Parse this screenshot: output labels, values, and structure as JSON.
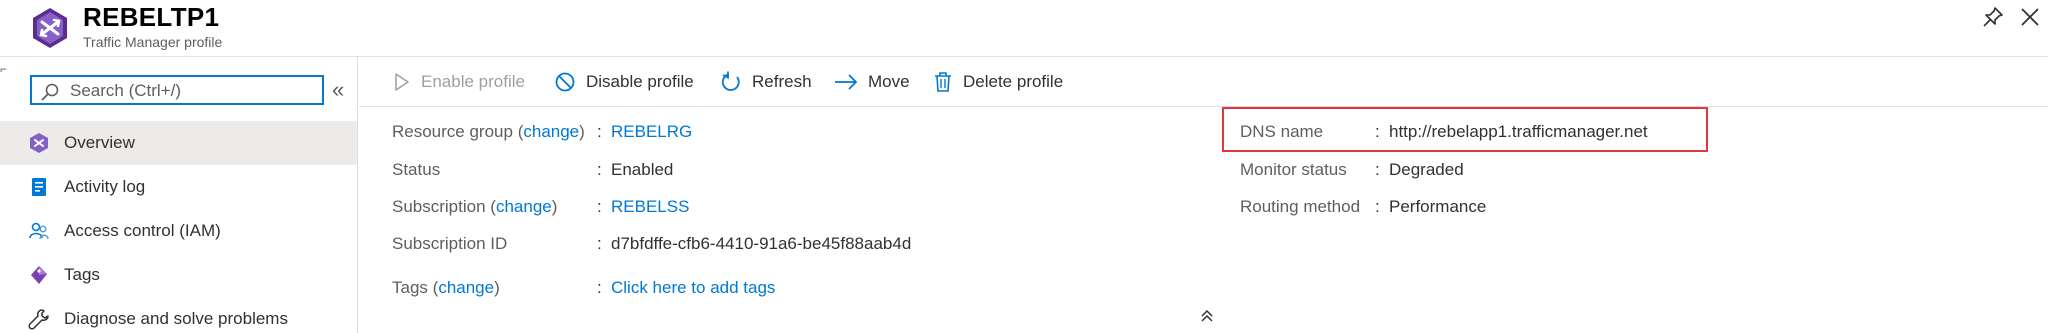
{
  "header": {
    "title": "REBELTP1",
    "subtitle": "Traffic Manager profile",
    "logo_icon": "traffic-manager-icon",
    "pin_icon": "pin-icon",
    "close_icon": "close-icon"
  },
  "search": {
    "placeholder": "Search (Ctrl+/)",
    "value": ""
  },
  "sidebar": {
    "collapse_glyph": "«",
    "items": [
      {
        "label": "Overview",
        "icon": "overview-icon",
        "active": true
      },
      {
        "label": "Activity log",
        "icon": "activity-log-icon",
        "active": false
      },
      {
        "label": "Access control (IAM)",
        "icon": "access-control-icon",
        "active": false
      },
      {
        "label": "Tags",
        "icon": "tag-icon",
        "active": false
      },
      {
        "label": "Diagnose and solve problems",
        "icon": "wrench-icon",
        "active": false
      }
    ]
  },
  "toolbar": {
    "enable_label": "Enable profile",
    "disable_label": "Disable profile",
    "refresh_label": "Refresh",
    "move_label": "Move",
    "delete_label": "Delete profile"
  },
  "essentials": {
    "left": [
      {
        "label": "Resource group",
        "change": "change",
        "value": "REBELRG",
        "link": true
      },
      {
        "label": "Status",
        "value": "Enabled",
        "link": false
      },
      {
        "label": "Subscription",
        "change": "change",
        "value": "REBELSS",
        "link": true
      },
      {
        "label": "Subscription ID",
        "value": "d7bfdffe-cfb6-4410-91a6-be45f88aab4d",
        "link": false
      },
      {
        "label": "Tags",
        "change": "change",
        "value": "Click here to add tags",
        "link": true
      }
    ],
    "right": [
      {
        "label": "DNS name",
        "value": "http://rebelapp1.trafficmanager.net",
        "highlighted": true
      },
      {
        "label": "Monitor status",
        "value": "Degraded"
      },
      {
        "label": "Routing method",
        "value": "Performance"
      }
    ],
    "colon": ":"
  },
  "colors": {
    "accent": "#0078d4",
    "highlight_border": "#e0383e",
    "active_nav_bg": "#edebe9"
  }
}
